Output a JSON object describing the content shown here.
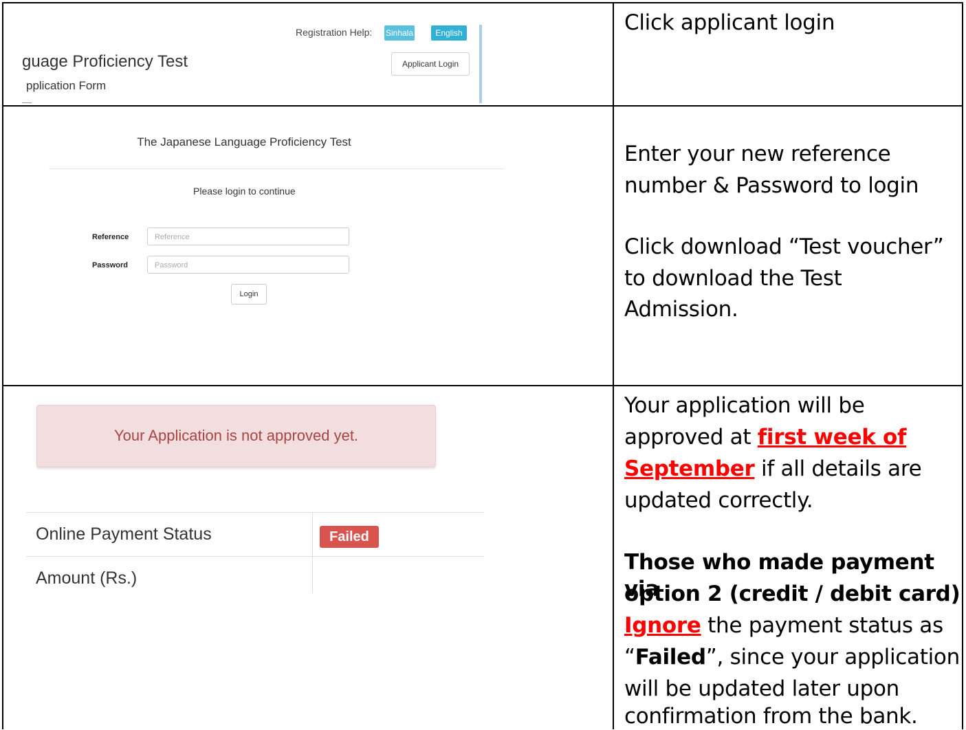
{
  "row1": {
    "screenshot": {
      "registration_help_label": "Registration Help:",
      "sinhala_button": "Sinhala",
      "english_button": "English",
      "title_fragment": "guage Proficiency Test",
      "subtitle_fragment": "pplication Form",
      "applicant_login_button": "Applicant Login"
    },
    "instruction": "Click applicant login"
  },
  "row2": {
    "screenshot": {
      "title": "The Japanese Language Proficiency Test",
      "prompt": "Please login to continue",
      "reference_label": "Reference",
      "reference_placeholder": "Reference",
      "password_label": "Password",
      "password_placeholder": "Password",
      "login_button": "Login"
    },
    "instruction_lines": [
      "Enter your new reference",
      "number & Password to login"
    ],
    "voucher_lines": [
      "Click download “Test voucher”",
      "to download the Test",
      "Admission."
    ]
  },
  "row3": {
    "screenshot": {
      "alert_text": "Your Application is not approved yet.",
      "payment_status_label": "Online Payment Status",
      "payment_status_badge": "Failed",
      "amount_label": "Amount (Rs.)"
    },
    "approval": {
      "line1": "Your application will be",
      "line2_prefix": "approved at ",
      "highlight_part1": "first week of",
      "highlight_part2": "September",
      "line3_suffix": " if all details are",
      "line4": "updated correctly."
    },
    "payment_note": {
      "bold_line1": "Those who made payment via",
      "bold_line2": "option 2 (credit / debit card)",
      "ignore_word": "Ignore",
      "line3_suffix": " the payment status as",
      "quote_open": "“",
      "failed_word": "Failed",
      "line4_suffix": "”, since your application",
      "line5": "will be updated later upon",
      "line6": "confirmation from the bank."
    }
  },
  "colors": {
    "info_button": "#5bc0de",
    "alert_bg": "#f2dede",
    "alert_text": "#a94442",
    "danger_badge": "#d9534f",
    "highlight_red": "#ff0000"
  }
}
